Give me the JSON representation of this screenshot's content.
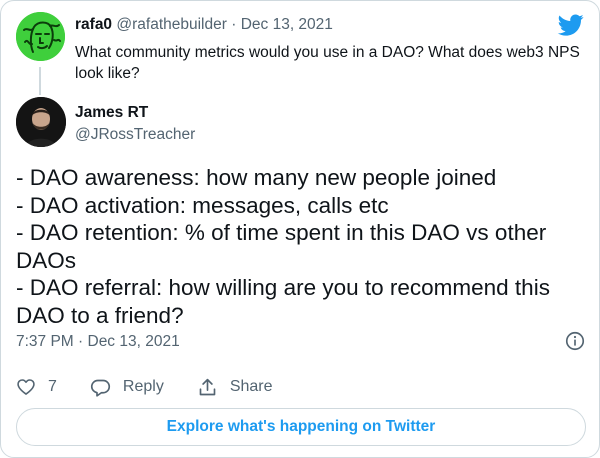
{
  "parent_tweet": {
    "name": "rafa0",
    "handle": "@rafathebuilder",
    "separator": "·",
    "date": "Dec 13, 2021",
    "text": "What community metrics would you use in a DAO? What does web3 NPS look like?",
    "avatar_color": "#3fcf3c"
  },
  "main_tweet": {
    "name": "James RT",
    "handle": "@JRossTreacher",
    "lines": [
      "- DAO awareness: how many new people joined",
      "- DAO activation: messages, calls etc",
      "- DAO retention: % of time spent in this DAO vs other",
      "DAOs",
      "- DAO referral: how willing are you to recommend this",
      "DAO to a friend?"
    ],
    "timestamp": "7:37 PM · Dec 13, 2021"
  },
  "actions": {
    "like_count": "7",
    "reply_label": "Reply",
    "share_label": "Share"
  },
  "explore_label": "Explore what's happening on Twitter",
  "colors": {
    "brand_blue": "#1d9bf0",
    "muted_text": "#536471",
    "border": "#cfd9de"
  },
  "icons": {
    "brand": "twitter-bird-icon",
    "info": "info-icon",
    "like": "heart-icon",
    "reply": "reply-bubble-icon",
    "share": "share-arrow-icon"
  }
}
